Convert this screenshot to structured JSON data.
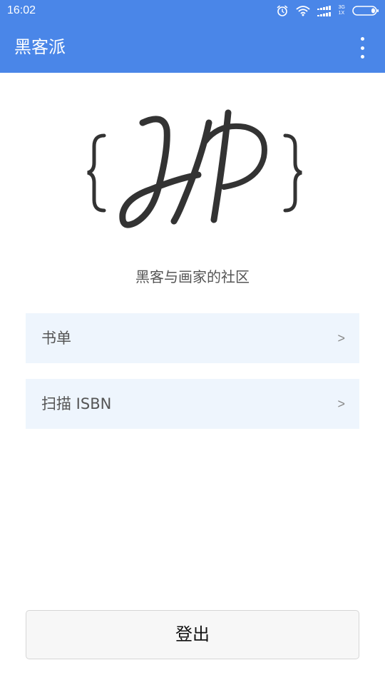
{
  "status_bar": {
    "time": "16:02",
    "network_top": "3G",
    "network_bottom": "1X",
    "icons": [
      "alarm-clock-icon",
      "wifi-icon",
      "signal-icon",
      "battery-icon"
    ]
  },
  "app_bar": {
    "title": "黑客派",
    "menu_icon": "overflow-menu-icon",
    "background_color": "#4a86e8"
  },
  "logo": {
    "text": "{HP}"
  },
  "tagline": "黑客与画家的社区",
  "menu": [
    {
      "label": "书单",
      "chevron": ">"
    },
    {
      "label": "扫描 ISBN",
      "chevron": ">"
    }
  ],
  "logout": {
    "label": "登出"
  }
}
